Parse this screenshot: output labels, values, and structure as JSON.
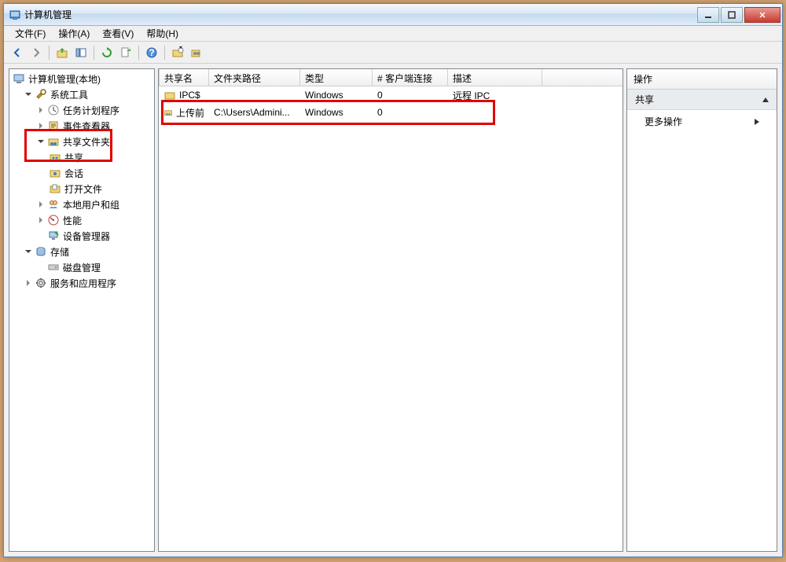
{
  "window": {
    "title": "计算机管理"
  },
  "menubar": [
    "文件(F)",
    "操作(A)",
    "查看(V)",
    "帮助(H)"
  ],
  "tree": {
    "root": "计算机管理(本地)",
    "system_tools": "系统工具",
    "task_scheduler": "任务计划程序",
    "event_viewer": "事件查看器",
    "shared_folders": "共享文件夹",
    "shares": "共享",
    "sessions": "会话",
    "open_files": "打开文件",
    "local_users": "本地用户和组",
    "performance": "性能",
    "device_mgr": "设备管理器",
    "storage": "存储",
    "disk_mgmt": "磁盘管理",
    "services_apps": "服务和应用程序"
  },
  "list": {
    "columns": [
      "共享名",
      "文件夹路径",
      "类型",
      "# 客户端连接",
      "描述"
    ],
    "rows": [
      {
        "name": "IPC$",
        "path": "",
        "type": "Windows",
        "conn": "0",
        "desc": "远程 IPC"
      },
      {
        "name": "上传前",
        "path": "C:\\Users\\Admini...",
        "type": "Windows",
        "conn": "0",
        "desc": ""
      }
    ]
  },
  "actions": {
    "header": "操作",
    "section": "共享",
    "more": "更多操作"
  }
}
